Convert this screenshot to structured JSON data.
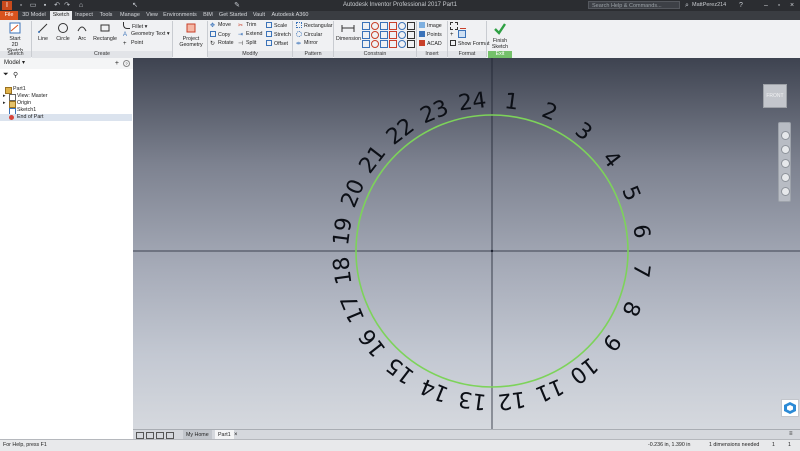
{
  "app": {
    "title": "Autodesk Inventor Professional 2017    Part1",
    "search_placeholder": "Search Help & Commands...",
    "user": "MattPerez214"
  },
  "tabs": [
    "File",
    "3D Model",
    "Sketch",
    "Inspect",
    "Tools",
    "Manage",
    "View",
    "Environments",
    "BIM",
    "Get Started",
    "Vault",
    "Autodesk A360"
  ],
  "active_tab": "Sketch",
  "ribbon": {
    "sketch_panel": {
      "start_label": "Start\n2D Sketch",
      "panel": "Sketch"
    },
    "create_panel": {
      "line": "Line",
      "circle": "Circle",
      "arc": "Arc",
      "rectangle": "Rectangle",
      "fillet": "Fillet",
      "text": "Geometry Text",
      "point": "Point",
      "panel": "Create"
    },
    "project_geometry": "Project\nGeometry",
    "modify_panel": {
      "move": "Move",
      "trim": "Trim",
      "scale": "Scale",
      "copy": "Copy",
      "extend": "Extend",
      "stretch": "Stretch",
      "rotate": "Rotate",
      "split": "Split",
      "offset": "Offset",
      "panel": "Modify"
    },
    "pattern_panel": {
      "rectangular": "Rectangular",
      "circular": "Circular",
      "mirror": "Mirror",
      "panel": "Pattern"
    },
    "dimension": "Dimension",
    "constrain_panel": "Constrain",
    "insert_panel": {
      "image": "Image",
      "points": "Points",
      "acad": "ACAD",
      "panel": "Insert"
    },
    "format_panel": {
      "show_format": "Show Format",
      "panel": "Format"
    },
    "exit_panel": {
      "finish": "Finish\nSketch",
      "panel": "Exit"
    }
  },
  "browser": {
    "header": "Model",
    "items": [
      {
        "label": "Part1"
      },
      {
        "label": "View: Master"
      },
      {
        "label": "Origin"
      },
      {
        "label": "Sketch1"
      },
      {
        "label": "End of Part"
      }
    ]
  },
  "viewcube_label": "FRONT",
  "dial_numbers": [
    "1",
    "2",
    "3",
    "4",
    "5",
    "6",
    "7",
    "8",
    "9",
    "10",
    "11",
    "12",
    "13",
    "14",
    "15",
    "16",
    "17",
    "18",
    "19",
    "20",
    "21",
    "22",
    "23",
    "24"
  ],
  "doc_tabs": [
    "My Home",
    "Part1"
  ],
  "status": {
    "left": "For Help, press F1",
    "coords": "-0.236 in, 1.390 in",
    "dimensions": "1 dimensions needed",
    "count1": "1",
    "count2": "1"
  },
  "colors": {
    "accent": "#d9531e",
    "circle": "#7dd35a",
    "finish": "#2ea043"
  }
}
